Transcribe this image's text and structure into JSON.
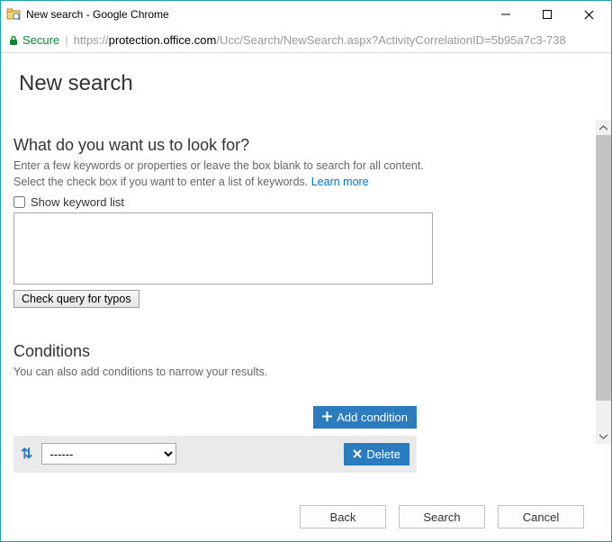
{
  "window": {
    "title": "New search - Google Chrome"
  },
  "addressbar": {
    "secure_label": "Secure",
    "url_domain": "protection.office.com",
    "url_path": "/Ucc/Search/NewSearch.aspx?ActivityCorrelationID=5b95a7c3-738"
  },
  "page": {
    "title": "New search"
  },
  "lookfor": {
    "heading": "What do you want us to look for?",
    "help_line1": "Enter a few keywords or properties or leave the box blank to search for all content.",
    "help_line2": "Select the check box if you want to enter a list of keywords. ",
    "learn_more": "Learn more",
    "show_keyword_label": "Show keyword list",
    "check_typos": "Check query for typos"
  },
  "conditions": {
    "heading": "Conditions",
    "help": "You can also add conditions to narrow your results.",
    "add_label": "Add condition",
    "delete_label": "Delete",
    "select_display": "------"
  },
  "footer": {
    "back": "Back",
    "search": "Search",
    "cancel": "Cancel"
  }
}
